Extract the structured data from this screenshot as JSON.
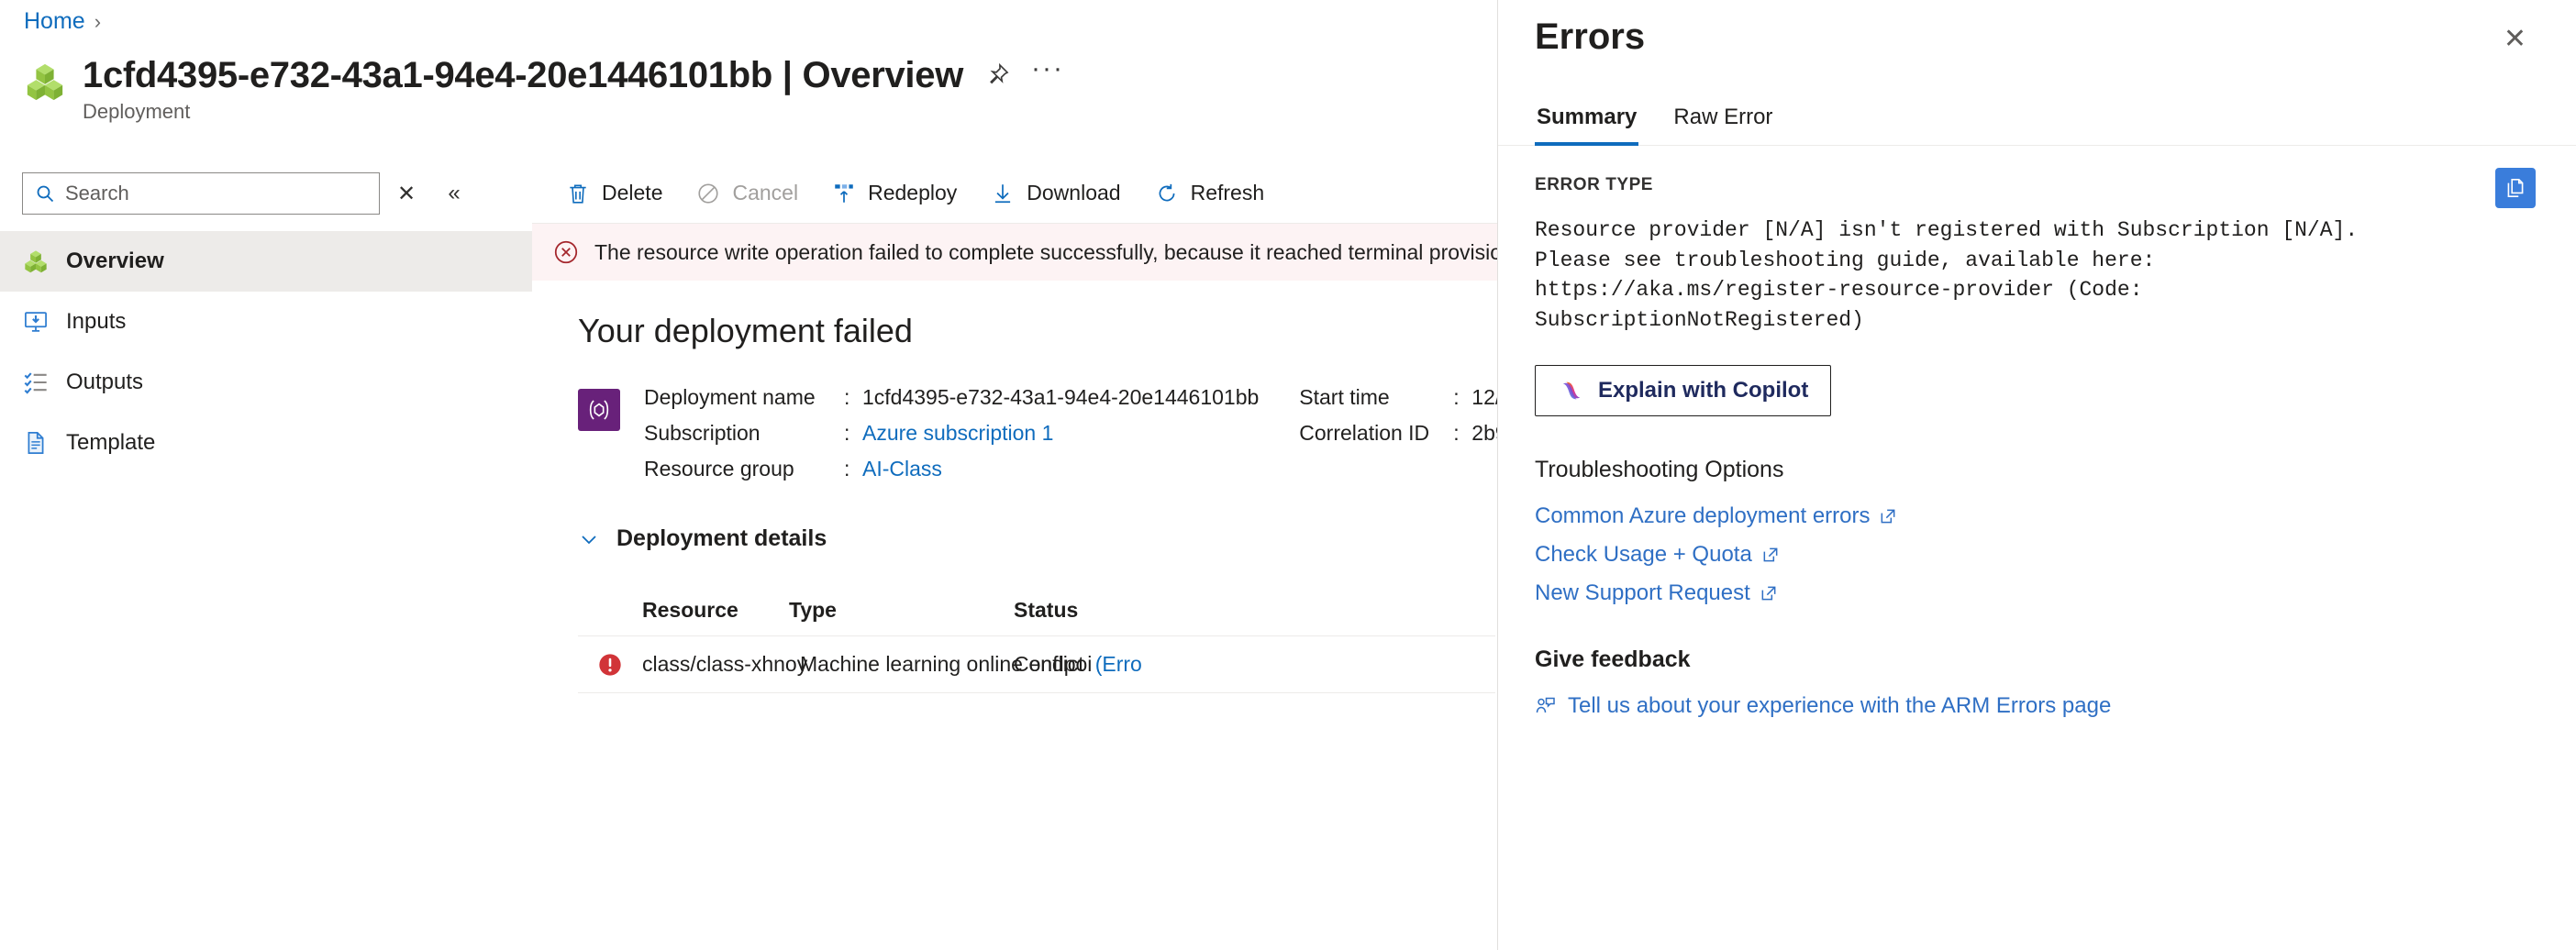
{
  "breadcrumb": {
    "home": "Home",
    "separator": "›"
  },
  "header": {
    "title": "1cfd4395-e732-43a1-94e4-20e1446101bb | Overview",
    "subtitle": "Deployment",
    "pin_icon": "pin-icon",
    "more_icon": "ellipsis-icon",
    "more_label": "···"
  },
  "sidebar": {
    "search": {
      "placeholder": "Search",
      "value": ""
    },
    "clear_label": "✕",
    "collapse_label": "«",
    "items": [
      {
        "label": "Overview",
        "icon": "cubes-icon",
        "selected": true
      },
      {
        "label": "Inputs",
        "icon": "inputs-icon",
        "selected": false
      },
      {
        "label": "Outputs",
        "icon": "outputs-icon",
        "selected": false
      },
      {
        "label": "Template",
        "icon": "template-icon",
        "selected": false
      }
    ]
  },
  "toolbar": {
    "delete_label": "Delete",
    "cancel_label": "Cancel",
    "redeploy_label": "Redeploy",
    "download_label": "Download",
    "refresh_label": "Refresh"
  },
  "banner": {
    "text": "The resource write operation failed to complete successfully, because it reached terminal provision",
    "icon": "error-circle-icon",
    "bg_color": "#fdf3f4",
    "icon_color": "#a4262c"
  },
  "main": {
    "heading": "Your deployment failed",
    "meta": {
      "deployment_name_label": "Deployment name",
      "deployment_name_value": "1cfd4395-e732-43a1-94e4-20e1446101bb",
      "subscription_label": "Subscription",
      "subscription_value": "Azure subscription 1",
      "resource_group_label": "Resource group",
      "resource_group_value": "AI-Class",
      "start_time_label": "Start time",
      "start_time_value": "12/",
      "correlation_id_label": "Correlation ID",
      "correlation_id_value": "2b9",
      "colon": ":"
    },
    "details": {
      "section_title": "Deployment details",
      "columns": {
        "resource": "Resource",
        "type": "Type",
        "status": "Status"
      },
      "rows": [
        {
          "status_icon": "error-badge-icon",
          "resource": "class/class-xhnoy",
          "type_icon": "machine-learning-icon",
          "type": "Machine learning online endpoi",
          "status": "Conflict ",
          "status_link": "(Erro"
        }
      ]
    }
  },
  "panel": {
    "title": "Errors",
    "close_label": "✕",
    "tabs": [
      {
        "label": "Summary",
        "active": true
      },
      {
        "label": "Raw Error",
        "active": false
      }
    ],
    "error_type_label": "ERROR TYPE",
    "error_text": "Resource provider [N/A] isn't registered with Subscription [N/A].\nPlease see troubleshooting guide, available here:\nhttps://aka.ms/register-resource-provider (Code:\nSubscriptionNotRegistered)",
    "copy_icon": "copy-icon",
    "copilot_button_label": "Explain with Copilot",
    "troubleshooting_title": "Troubleshooting Options",
    "troubleshooting_links": [
      "Common Azure deployment errors",
      "Check Usage + Quota",
      "New Support Request"
    ],
    "feedback_title": "Give feedback",
    "feedback_link": "Tell us about your experience with the ARM Errors page"
  },
  "colors": {
    "accent": "#0f6cbd",
    "link": "#2f6fc4",
    "error": "#a4262c",
    "selected_bg": "#edebe9",
    "copy_btn": "#3a7ddb",
    "badge_purple": "#68217a"
  }
}
